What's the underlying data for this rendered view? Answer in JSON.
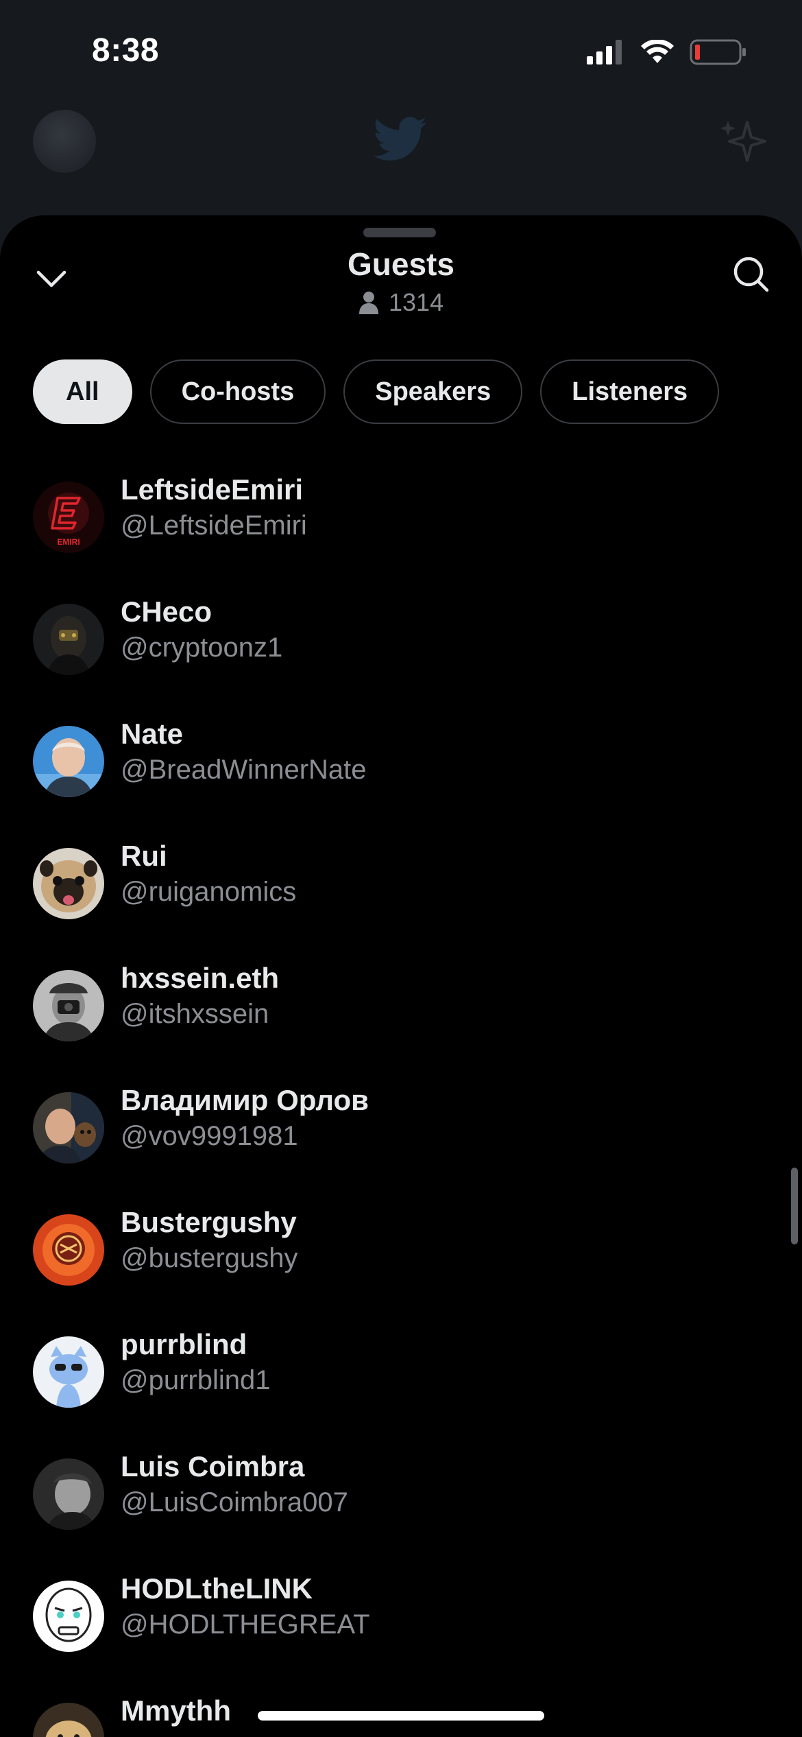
{
  "status_bar": {
    "time": "8:38"
  },
  "sheet": {
    "title": "Guests",
    "listener_count": "1314"
  },
  "tabs": [
    {
      "label": "All",
      "active": true
    },
    {
      "label": "Co-hosts",
      "active": false
    },
    {
      "label": "Speakers",
      "active": false
    },
    {
      "label": "Listeners",
      "active": false
    }
  ],
  "guests": [
    {
      "name": "LeftsideEmiri",
      "handle": "@LeftsideEmiri"
    },
    {
      "name": "CHeco",
      "handle": "@cryptoonz1"
    },
    {
      "name": "Nate",
      "handle": "@BreadWinnerNate"
    },
    {
      "name": "Rui",
      "handle": "@ruiganomics"
    },
    {
      "name": "hxssein.eth",
      "handle": "@itshxssein"
    },
    {
      "name": "Владимир Орлов",
      "handle": "@vov9991981"
    },
    {
      "name": "Bustergushy",
      "handle": "@bustergushy"
    },
    {
      "name": "purrblind",
      "handle": "@purrblind1"
    },
    {
      "name": "Luis Coimbra",
      "handle": "@LuisCoimbra007"
    },
    {
      "name": "HODLtheLINK",
      "handle": "@HODLTHEGREAT"
    },
    {
      "name": "Mmythh",
      "handle": ""
    }
  ],
  "colors": {
    "sheet_background": "#000000",
    "primary_text": "#e7e9ea",
    "secondary_text": "#8b8f94",
    "active_tab_bg": "#e6e7e8",
    "battery_low": "#eb3b35"
  },
  "icons": {
    "collapse": "chevron-down-icon",
    "search": "search-icon",
    "listeners": "person-icon",
    "header_logo": "twitter-bird-icon",
    "header_right": "sparkle-icon"
  }
}
